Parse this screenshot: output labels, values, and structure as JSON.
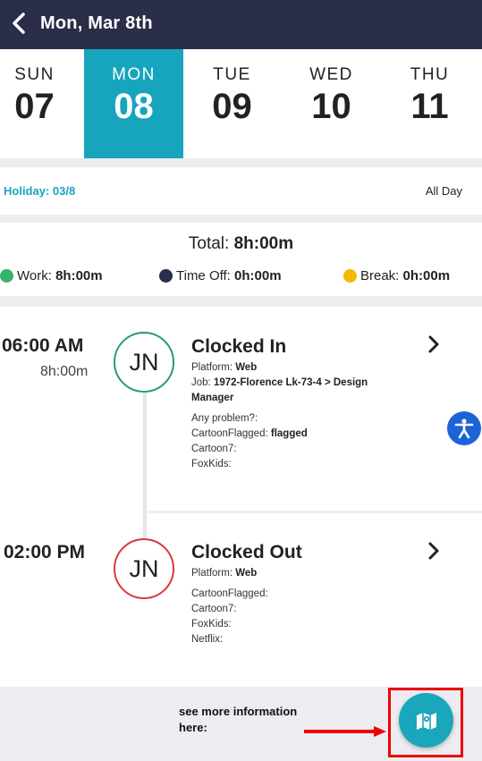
{
  "header": {
    "title": "Mon, Mar 8th"
  },
  "days": [
    {
      "name": "SUN",
      "num": "07"
    },
    {
      "name": "MON",
      "num": "08"
    },
    {
      "name": "TUE",
      "num": "09"
    },
    {
      "name": "WED",
      "num": "10"
    },
    {
      "name": "THU",
      "num": "11"
    }
  ],
  "holiday": {
    "label": "Holiday:  03/8",
    "value": "All Day"
  },
  "totals": {
    "total_label": "Total:",
    "total_value": "8h:00m",
    "work_label": "Work:",
    "work_value": "8h:00m",
    "timeoff_label": "Time Off:",
    "timeoff_value": "0h:00m",
    "break_label": "Break:",
    "break_value": "0h:00m"
  },
  "entries": [
    {
      "time": "06:00 AM",
      "duration": "8h:00m",
      "initials": "JN",
      "title": "Clocked In",
      "platform_label": "Platform:",
      "platform_value": "Web",
      "job_label": "Job:",
      "job_value": "1972-Florence Lk-73-4 > Design Manager",
      "any_problem": "Any problem?:",
      "cartoon_flagged_label": "CartoonFlagged:",
      "cartoon_flagged_value": "flagged",
      "cartoon7": "Cartoon7:",
      "foxkids": "FoxKids:"
    },
    {
      "time": "02:00 PM",
      "initials": "JN",
      "title": "Clocked Out",
      "platform_label": "Platform:",
      "platform_value": "Web",
      "cartoon_flagged": "CartoonFlagged:",
      "cartoon7": "Cartoon7:",
      "foxkids": "FoxKids:",
      "netflix": "Netflix:"
    }
  ],
  "footer": {
    "hint_line1": "see more information",
    "hint_line2": "here:"
  },
  "colors": {
    "header_bg": "#2b2e48",
    "accent": "#17a4bd",
    "work": "#35b36b",
    "time_off": "#2b2e48",
    "break": "#f5b800",
    "clock_in": "#2a9a73",
    "clock_out": "#d63a3a",
    "highlight": "#e00000"
  },
  "icons": [
    "chevron-left-icon",
    "chevron-right-icon",
    "accessibility-icon",
    "map-icon"
  ]
}
